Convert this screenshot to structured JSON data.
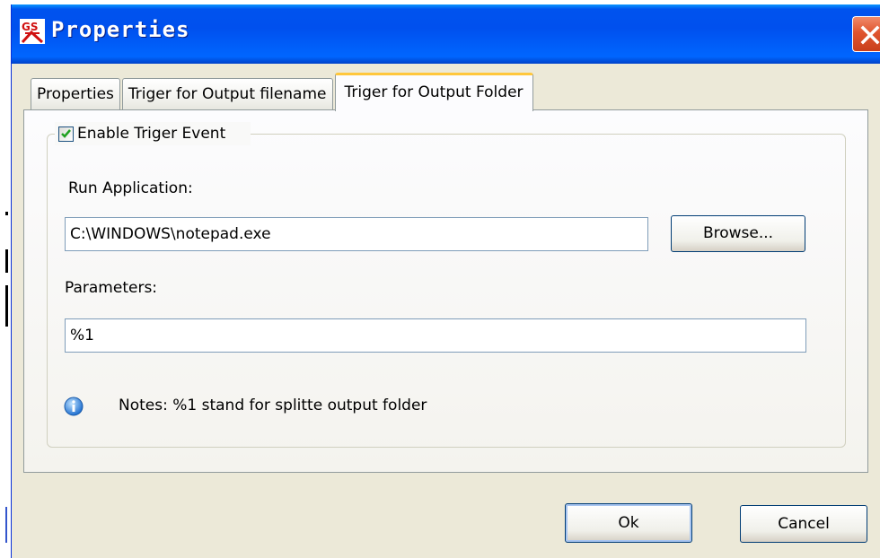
{
  "window": {
    "title": "Properties",
    "icon": "app-logo-icon",
    "close_icon": "close-icon",
    "title_color": "#0054e3"
  },
  "tabs": [
    {
      "label": "Properties",
      "active": false
    },
    {
      "label": "Triger for Output filename",
      "active": false
    },
    {
      "label": "Triger for Output Folder",
      "active": true
    }
  ],
  "group": {
    "checkbox_label": "Enable Triger Event",
    "checked": true
  },
  "run_application": {
    "label": "Run Application:",
    "value": "C:\\WINDOWS\\notepad.exe",
    "browse_label": "Browse..."
  },
  "parameters": {
    "label": "Parameters:",
    "value": "%1"
  },
  "notes": {
    "icon": "info-icon",
    "text": "Notes: %1 stand for splitte output folder"
  },
  "footer": {
    "ok_label": "Ok",
    "cancel_label": "Cancel"
  }
}
